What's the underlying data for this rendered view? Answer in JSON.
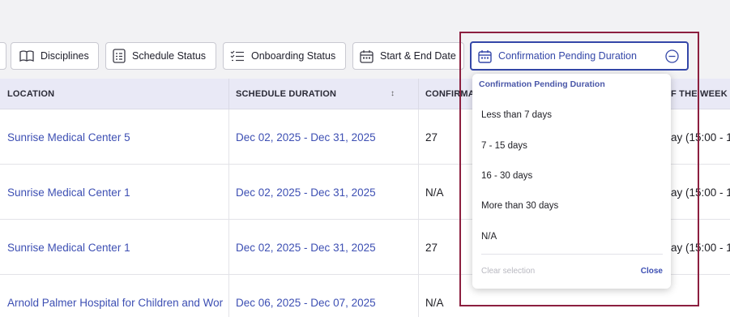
{
  "filters": {
    "disciplines_label": "Disciplines",
    "schedule_status_label": "Schedule Status",
    "onboarding_status_label": "Onboarding Status",
    "start_end_label": "Start & End Date",
    "confirmation_pending_label": "Confirmation Pending Duration",
    "active_color": "#3447a8"
  },
  "table": {
    "headers": {
      "location": "LOCATION",
      "schedule_duration": "SCHEDULE DURATION",
      "confirmation": "CONFIRMA",
      "days_of_week": "F THE WEEK"
    },
    "rows": [
      {
        "location": "Sunrise Medical Center 5",
        "schedule_duration": "Dec 02, 2025 - Dec 31, 2025",
        "confirmation": "27",
        "days": "ay (15:00 - 1"
      },
      {
        "location": "Sunrise Medical Center 1",
        "schedule_duration": "Dec 02, 2025 - Dec 31, 2025",
        "confirmation": "N/A",
        "days": "ay (15:00 - 1"
      },
      {
        "location": "Sunrise Medical Center 1",
        "schedule_duration": "Dec 02, 2025 - Dec 31, 2025",
        "confirmation": "27",
        "days": "ay (15:00 - 1"
      },
      {
        "location": "Arnold Palmer Hospital for Children and Wor",
        "schedule_duration": "Dec 06, 2025 - Dec 07, 2025",
        "confirmation": "N/A",
        "days": ""
      }
    ]
  },
  "dropdown": {
    "title": "Confirmation Pending Duration",
    "options": [
      "Less than 7 days",
      "7 - 15 days",
      "16 - 30 days",
      "More than 30 days",
      "N/A"
    ],
    "clear_label": "Clear selection",
    "close_label": "Close"
  },
  "highlight_color": "#8c1f3f"
}
